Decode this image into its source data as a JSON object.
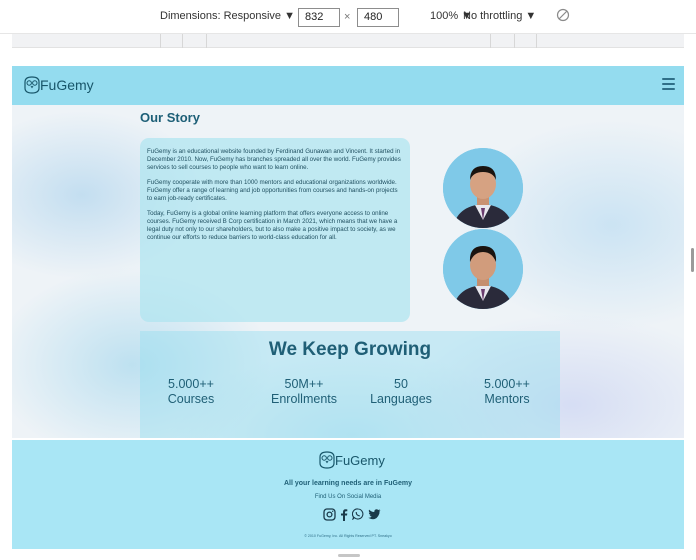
{
  "devtools": {
    "dimensions_label": "Dimensions: Responsive ▼",
    "width_value": "832",
    "times": "×",
    "height_value": "480",
    "zoom": "100% ▼",
    "throttling": "No throttling ▼",
    "rotate_icon": "rotate-icon"
  },
  "navbar": {
    "logo_text": "FuGemy",
    "logo_icon": "owl-logo-icon",
    "menu_icon": "hamburger-menu-icon"
  },
  "story": {
    "title": "Our Story",
    "paragraphs": [
      "FuGemy is an educational website founded by Ferdinand Gunawan and Vincent. It started in December 2010. Now, FuGemy has branches spreaded all over the world. FuGemy provides services to sell courses to people who want to learn online.",
      "FuGemy cooperate with more than 1000 mentors and educational organizations worldwide. FuGemy offer a range of learning and job opportunities from courses and hands-on projects to earn job-ready certificates.",
      "Today, FuGemy is a global online learning platform that offers everyone access to online courses. FuGemy received B Corp certification in March 2021, which means that we have a legal duty not only to our shareholders, but to also make a positive impact to society, as we continue our efforts to reduce barriers to world-class education for all."
    ]
  },
  "growing": {
    "title": "We Keep Growing",
    "stats": [
      {
        "value": "5.000++",
        "label": "Courses"
      },
      {
        "value": "50M++",
        "label": "Enrollments"
      },
      {
        "value": "50",
        "label": "Languages"
      },
      {
        "value": "5.000++",
        "label": "Mentors"
      }
    ]
  },
  "footer": {
    "logo_text": "FuGemy",
    "tagline": "All your learning needs are in FuGemy",
    "social_label": "Find Us On Social Media",
    "social_icons": [
      "instagram-icon",
      "facebook-icon",
      "whatsapp-icon",
      "twitter-icon"
    ],
    "copyright": "© 2010 FuGemy, Inc. All Rights Reserved PT. Sneakyo"
  },
  "colors": {
    "navbar": "#94dcef",
    "footer": "#a9e6f5",
    "heading": "#1f5f76",
    "card": "#afe4f0"
  }
}
